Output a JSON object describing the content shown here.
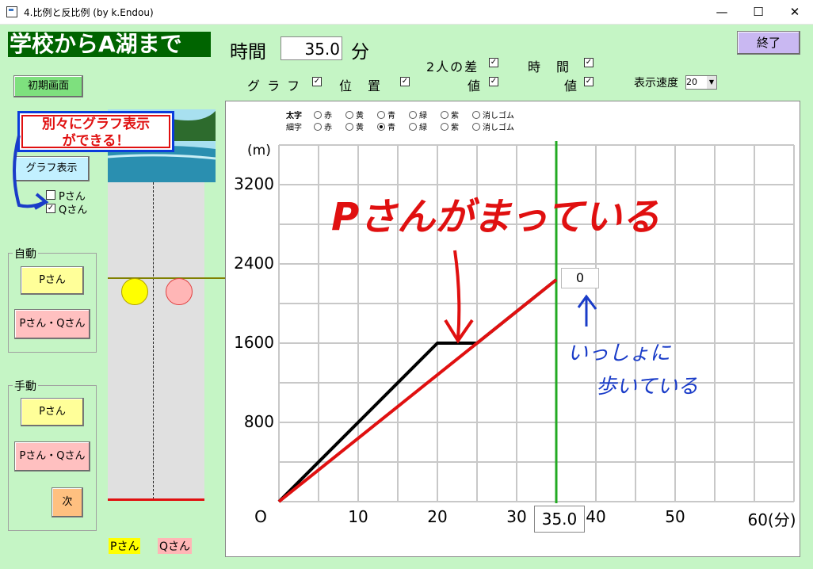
{
  "window": {
    "title": "4.比例と反比例 (by k.Endou)",
    "minimize": "—",
    "maximize": "☐",
    "close": "✕"
  },
  "header": {
    "title": "学校からA湖まで",
    "time_label": "時間",
    "time_value": "35.0",
    "time_unit": "分",
    "exit_button": "終了",
    "reset_button": "初期画面"
  },
  "options": {
    "diff_label": "2人の差",
    "time_label": "時　間",
    "graph_label": "グ ラ フ",
    "position_label": "位　置",
    "value_label_1": "値",
    "value_label_2": "値",
    "speed_label": "表示速度",
    "speed_value": "20"
  },
  "left_panel": {
    "callout_line1": "別々にグラフ表示",
    "callout_line2": "ができる！",
    "graph_button": "グラフ表示",
    "p_label": "Pさん",
    "q_label": "Qさん",
    "auto_group": "自動",
    "manual_group": "手動",
    "auto_p_button": "Pさん",
    "auto_pq_button": "Pさん・Qさん",
    "manual_p_button": "Pさん",
    "manual_pq_button": "Pさん・Qさん",
    "next_button": "次",
    "legend_p": "Pさん",
    "legend_q": "Qさん"
  },
  "pen_options": {
    "bold_label": "太字",
    "thin_label": "細字",
    "colors": [
      "赤",
      "黄",
      "青",
      "緑",
      "紫",
      "消しゴム"
    ],
    "thin_selected": "青"
  },
  "colors": {
    "p_person": "#ffff00",
    "q_person": "#ffb6b6",
    "p_line": "#000000",
    "q_line": "#e01010",
    "time_line": "#22aa22",
    "position_line": "#808000"
  },
  "chart_data": {
    "type": "line",
    "ylabel": "(m)",
    "xlabel": "(分)",
    "xlim": [
      0,
      65
    ],
    "ylim": [
      0,
      3200
    ],
    "x_ticks": [
      "O",
      "10",
      "20",
      "30",
      "40",
      "50",
      "60(分)"
    ],
    "y_ticks": [
      "3200",
      "2400",
      "1600",
      "800"
    ],
    "current_time_label": "35.0",
    "distance_diff_label": "0",
    "series": [
      {
        "x": [
          0,
          20,
          25,
          35
        ],
        "y": [
          0,
          1600,
          1600,
          2240
        ]
      },
      {
        "x": [
          0,
          35
        ],
        "y": [
          0,
          2240
        ]
      }
    ],
    "annotations": {
      "red": "Pさんがまっている",
      "blue_line1": "いっしょに",
      "blue_line2": "歩いている"
    }
  }
}
